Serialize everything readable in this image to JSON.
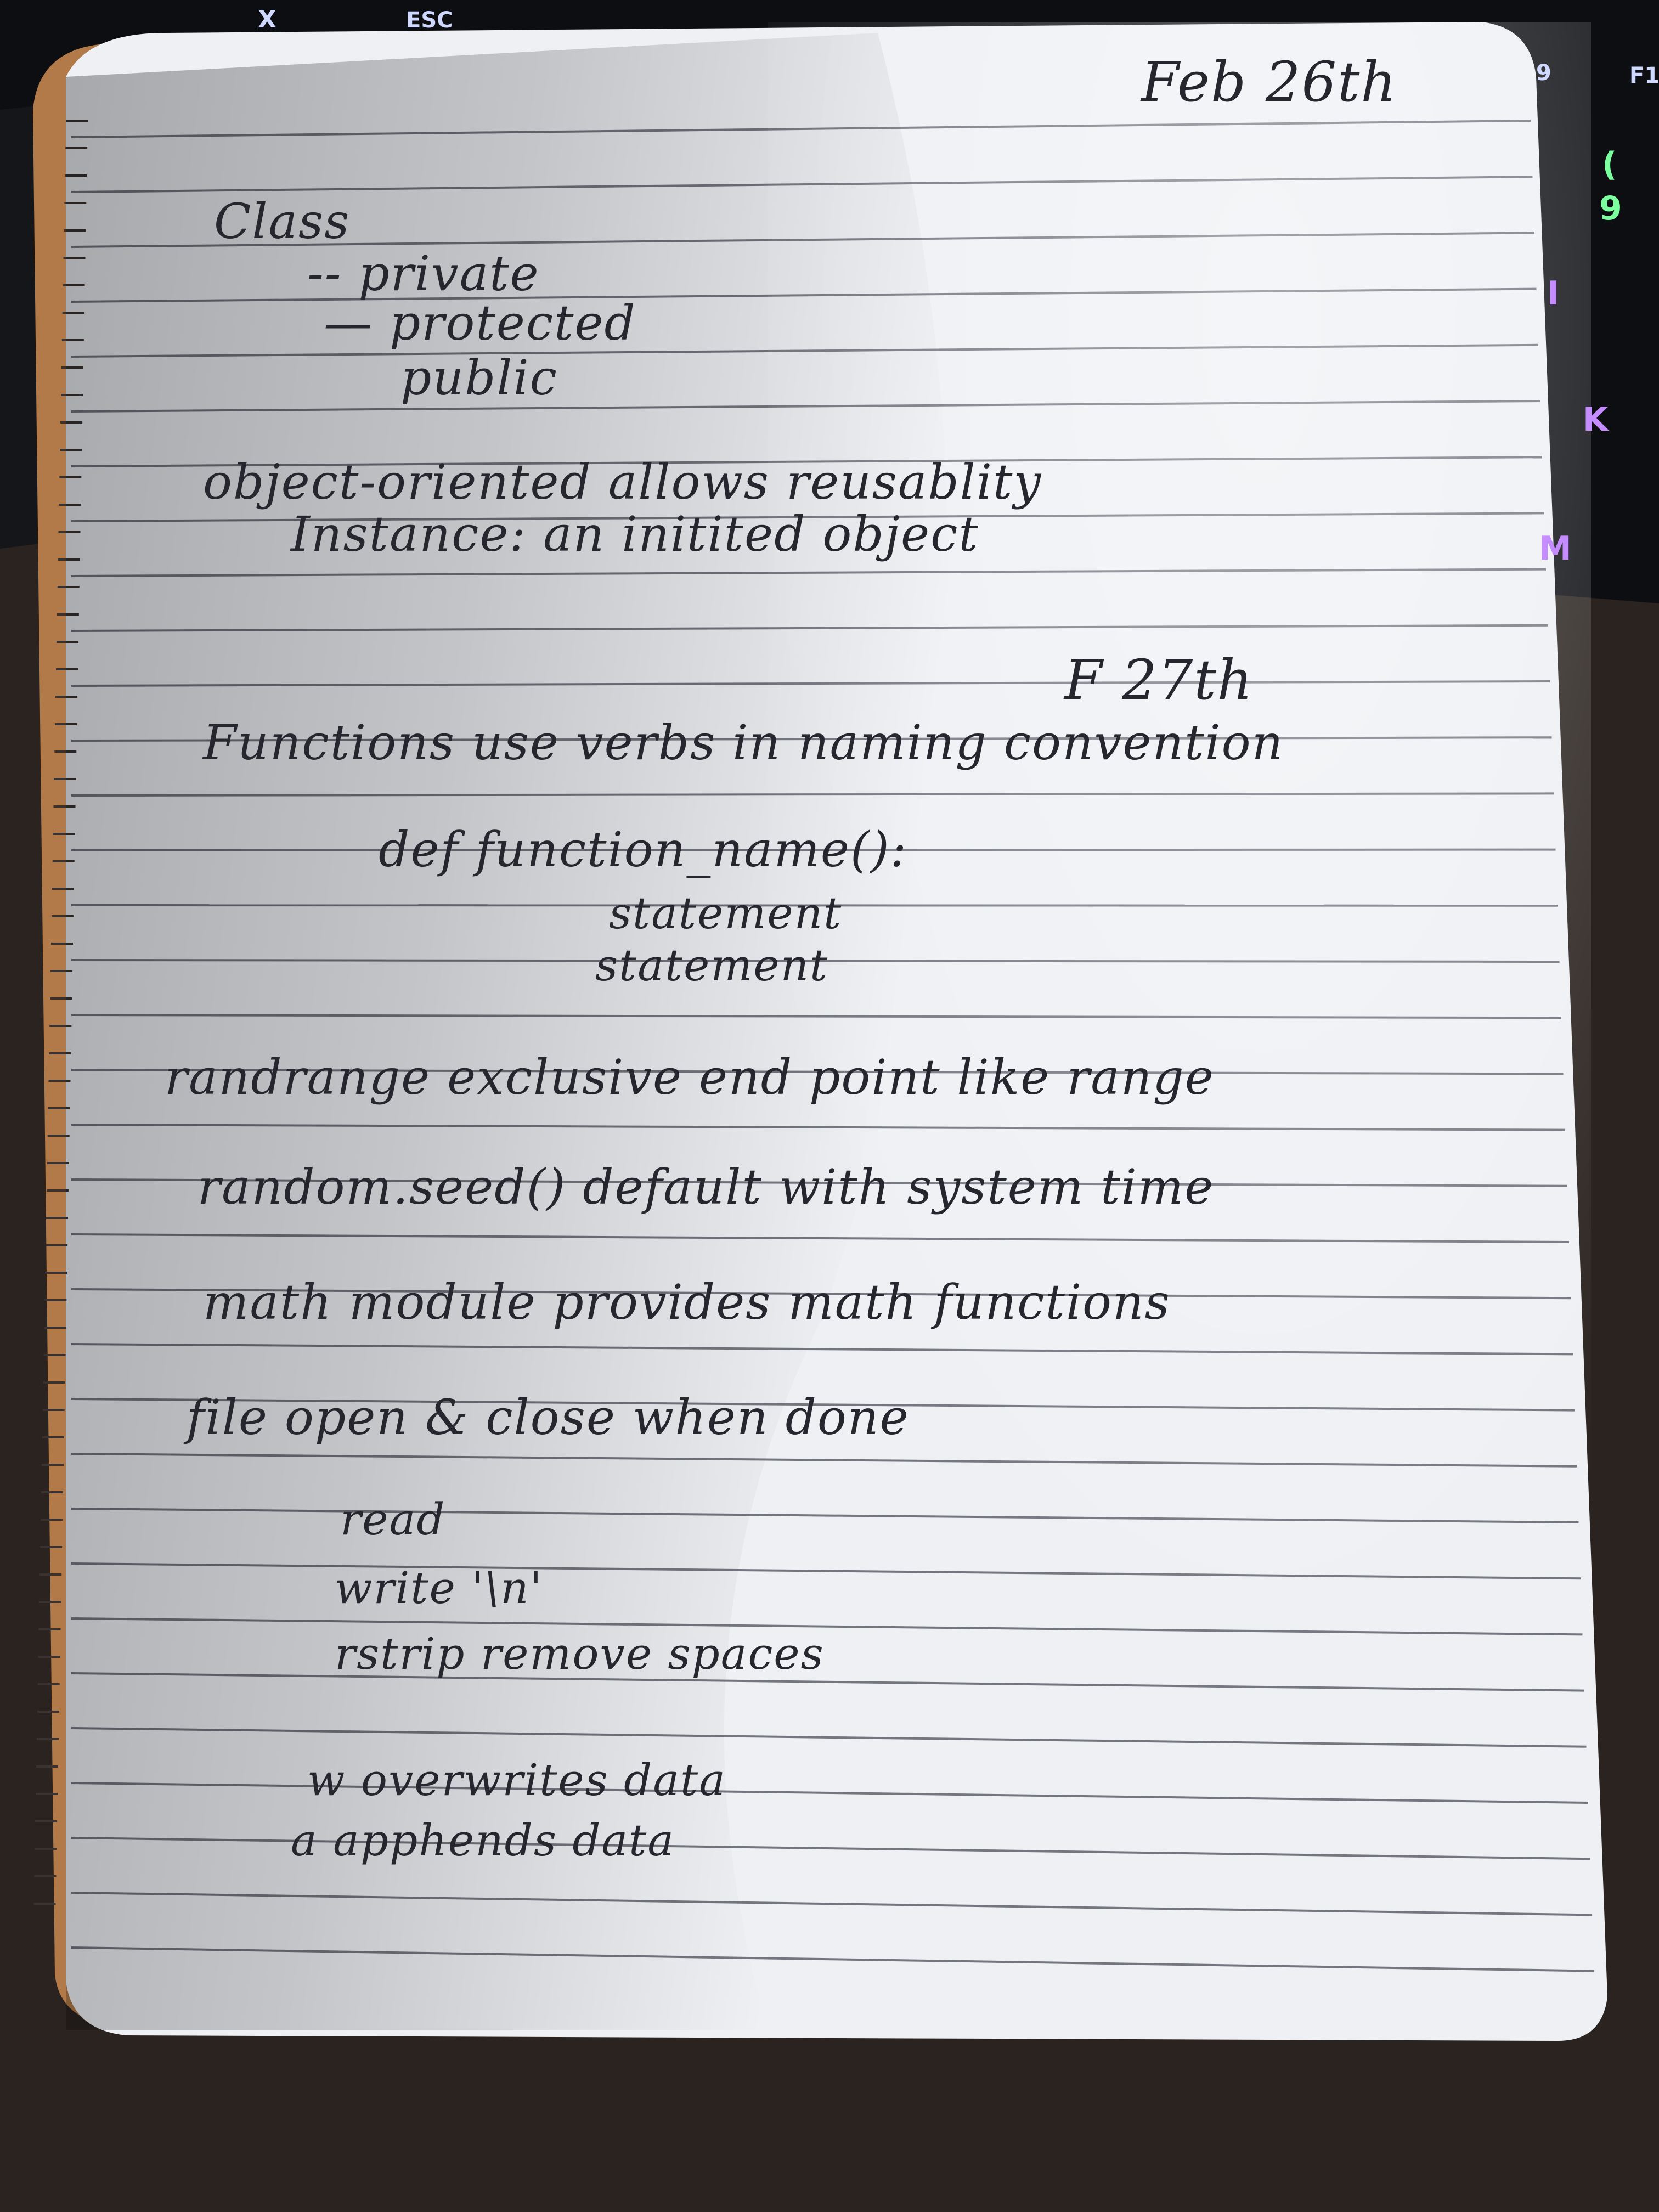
{
  "keyboard": {
    "keys": [
      {
        "label": "X"
      },
      {
        "label": "ESC"
      },
      {
        "label": "9"
      },
      {
        "label": "F1"
      },
      {
        "label": "("
      },
      {
        "label": "9"
      },
      {
        "label": "I"
      },
      {
        "label": "K"
      },
      {
        "label": "M"
      }
    ]
  },
  "notebook": {
    "date_1": "Feb 26th",
    "date_2": "F 27th",
    "lines": [
      "Class",
      "-- private",
      "— protected",
      "public",
      "object-oriented allows reusablity",
      "Instance: an initited object",
      "Functions use verbs in naming convention",
      "def function_name():",
      "statement",
      "statement",
      "randrange exclusive end point like range",
      "random.seed() default with system time",
      "math module provides math functions",
      "file open & close when done",
      "read",
      "write '\\n'",
      "rstrip remove spaces",
      "w overwrites data",
      "a apphends data"
    ]
  },
  "colors": {
    "desk": "#2a2320",
    "keyboard": "#0d0e12",
    "paper": "#eef0f4",
    "ink": "#26272e",
    "rule": "#4a4d58",
    "cover": "#b27a48",
    "key_glow_green": "#7cff9e",
    "key_glow_purple": "#c58cff"
  }
}
